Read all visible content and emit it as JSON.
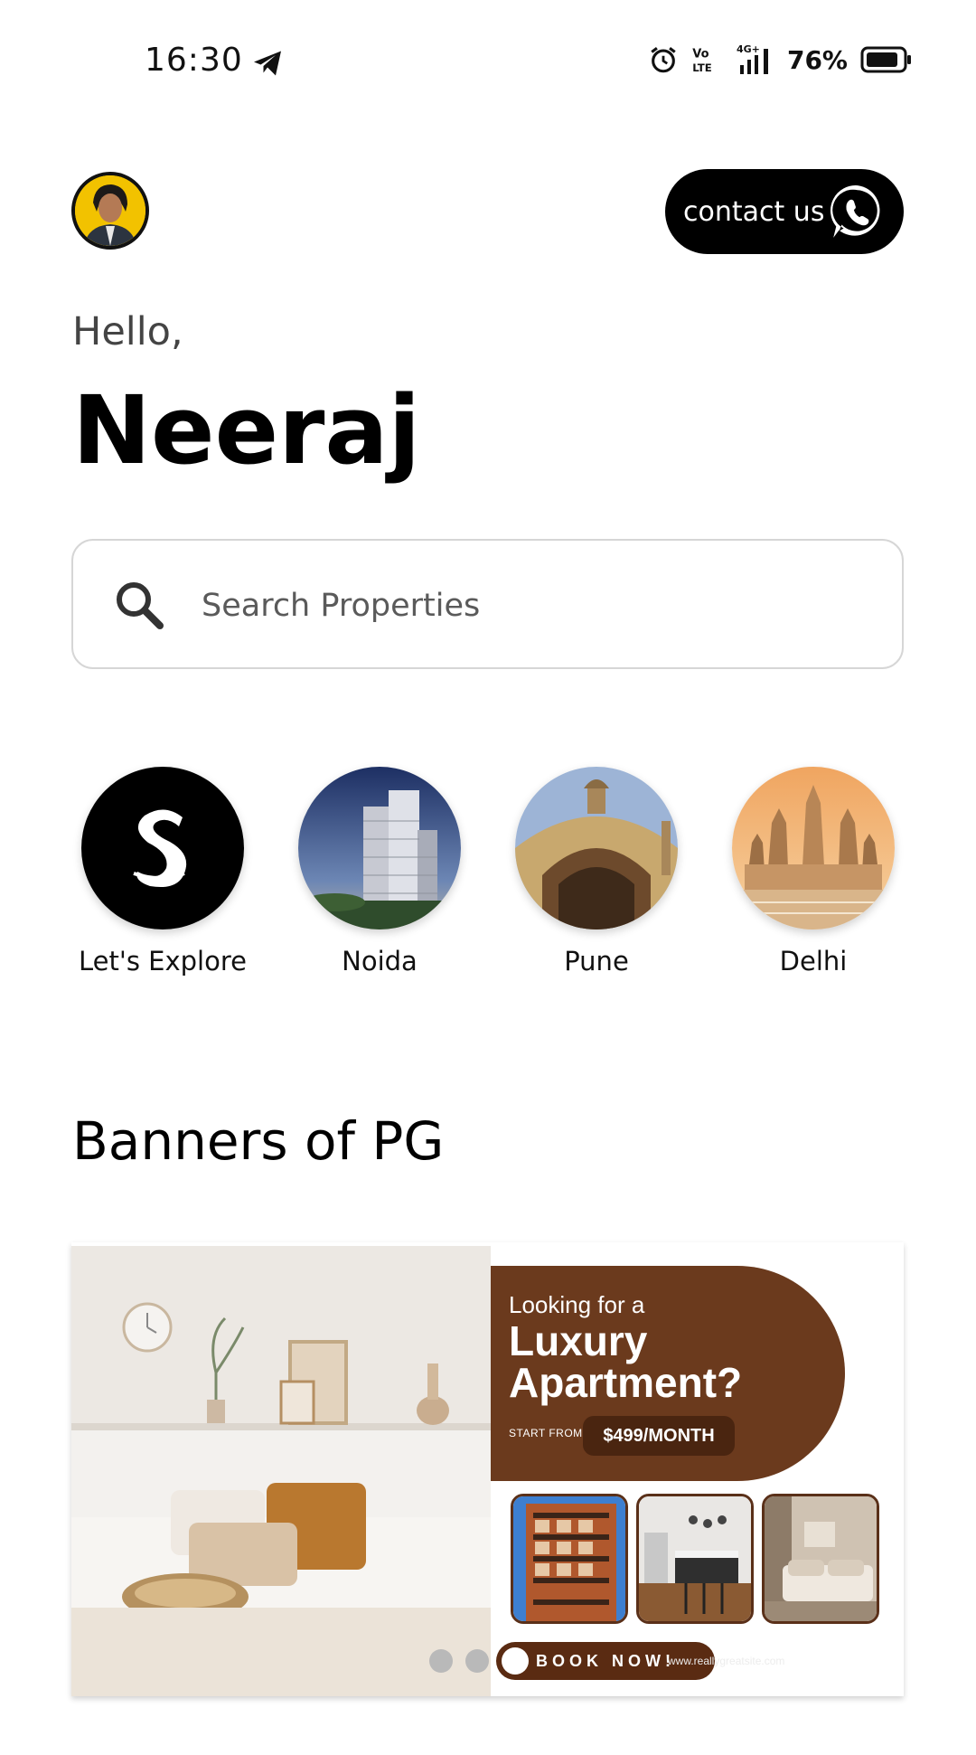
{
  "status_bar": {
    "time": "16:30",
    "network_label": "4G+",
    "volte_label": "Vo LTE",
    "battery": "76%"
  },
  "header": {
    "contact_label": "contact us"
  },
  "greeting": {
    "hello": "Hello,",
    "name": "Neeraj"
  },
  "search": {
    "placeholder": "Search Properties",
    "value": ""
  },
  "categories": [
    {
      "label": "Let's Explore",
      "icon": "brand-s-logo"
    },
    {
      "label": "Noida",
      "icon": "city-towers"
    },
    {
      "label": "Pune",
      "icon": "historic-arch"
    },
    {
      "label": "Delhi",
      "icon": "temple"
    }
  ],
  "banners_section": {
    "title": "Banners of PG"
  },
  "banner": {
    "kicker": "Looking for a",
    "headline": "Luxury Apartment?",
    "start_from": "START FROM",
    "price": "$499/MONTH",
    "cta": "BOOK NOW!",
    "website": "www.reallygreatsite.com",
    "slide_count": 3,
    "active_slide": 3
  },
  "colors": {
    "banner_brown": "#6b3a1d",
    "button_black": "#000000",
    "avatar_yellow": "#f2c200"
  }
}
